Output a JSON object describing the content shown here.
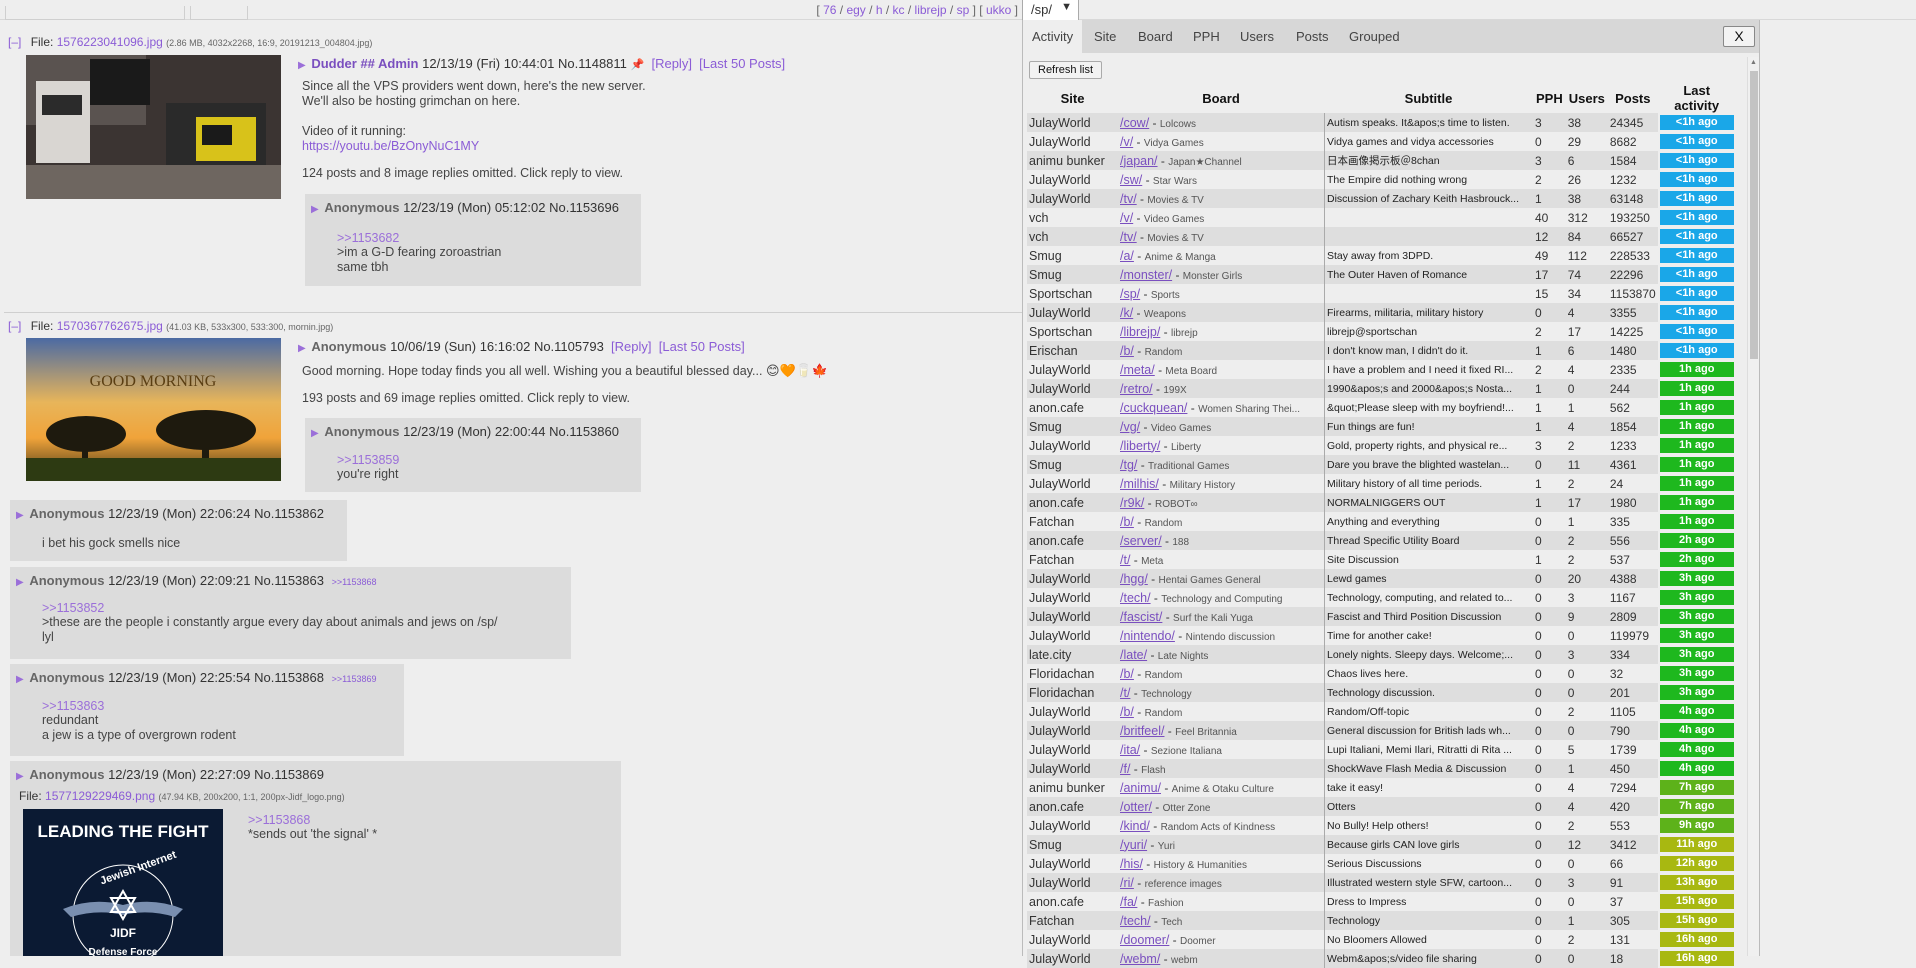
{
  "topnav": {
    "open": "[",
    "links": [
      "76",
      "egy",
      "h",
      "kc",
      "librejp",
      "sp"
    ],
    "mid": "] [",
    "extra": "ukko",
    "close": "]",
    "board_select": "/sp/"
  },
  "threads": [
    {
      "collapse": "[–]",
      "file_label": "File:",
      "file_name": "1576223041096.jpg",
      "file_info": "(2.86 MB, 4032x2268, 16:9, 20191213_004804.jpg)",
      "name": "Dudder ## Admin",
      "date": "12/13/19 (Fri) 10:44:01",
      "no": "No.1148811",
      "reply_link": "[Reply]",
      "last50": "[Last 50 Posts]",
      "body": [
        "Since all the VPS providers went down, here's the new server.",
        "We'll also be hosting grimchan on here."
      ],
      "body2": "Video of it running:",
      "link": "https://youtu.be/BzOnyNuC1MY",
      "omitted": "124 posts and 8 image replies omitted. Click reply to view."
    },
    {
      "collapse": "[–]",
      "file_label": "File:",
      "file_name": "1570367762675.jpg",
      "file_info": "(41.03 KB, 533x300, 533:300, mornin.jpg)",
      "thumb_text": "GOOD MORNING",
      "name": "Anonymous",
      "date": "10/06/19 (Sun) 16:16:02",
      "no": "No.1105793",
      "reply_link": "[Reply]",
      "last50": "[Last 50 Posts]",
      "body": "Good morning. Hope today finds you all well. Wishing you a beautiful blessed day...",
      "omitted": "193 posts and 69 image replies omitted. Click reply to view."
    }
  ],
  "replies": [
    {
      "name": "Anonymous",
      "date": "12/23/19 (Mon) 05:12:02",
      "no": "No.1153696",
      "backlink": "",
      "quote": ">>1153682",
      "green": ">im a G-D fearing zoroastrian",
      "text": "same tbh"
    },
    {
      "name": "Anonymous",
      "date": "12/23/19 (Mon) 22:00:44",
      "no": "No.1153860",
      "backlink": "",
      "quote": ">>1153859",
      "green": "",
      "text": "you're right"
    },
    {
      "name": "Anonymous",
      "date": "12/23/19 (Mon) 22:06:24",
      "no": "No.1153862",
      "backlink": "",
      "quote": "",
      "green": "",
      "text": "i bet his gock smells nice"
    },
    {
      "name": "Anonymous",
      "date": "12/23/19 (Mon) 22:09:21",
      "no": "No.1153863",
      "backlink": ">>1153868",
      "quote": ">>1153852",
      "green": ">these are the people i constantly argue every day about animals and jews on /sp/",
      "text": "lyl"
    },
    {
      "name": "Anonymous",
      "date": "12/23/19 (Mon) 22:25:54",
      "no": "No.1153868",
      "backlink": ">>1153869",
      "quote": ">>1153863",
      "green": "",
      "text": "redundant",
      "text2": "a jew is a type of overgrown rodent"
    },
    {
      "name": "Anonymous",
      "date": "12/23/19 (Mon) 22:27:09",
      "no": "No.1153869",
      "backlink": "",
      "file_label": "File:",
      "file_name": "1577129229469.png",
      "file_info": "(47.94 KB, 200x200, 1:1, 200px-Jidf_logo.png)",
      "thumb_title": "LEADING THE FIGHT",
      "thumb_arc": "Jewish Internet",
      "thumb_abbr": "JIDF",
      "thumb_bottom": "Defense Force",
      "quote": ">>1153868",
      "text": "*sends out 'the signal' *"
    }
  ],
  "panel": {
    "tabs": [
      "Activity",
      "Site",
      "Board",
      "PPH",
      "Users",
      "Posts",
      "Grouped"
    ],
    "close": "X",
    "refresh": "Refresh list",
    "headers": [
      "Site",
      "Board",
      "Subtitle",
      "PPH",
      "Users",
      "Posts",
      "Last activity"
    ],
    "colors": {
      "fresh": "#1aa7e8",
      "hour": "#1eb81e",
      "mid": "#5db21a",
      "old": "#a8b811"
    },
    "rows": [
      [
        "JulayWorld",
        "/cow/",
        "Lolcows",
        "Autism speaks. It&apos;s time to listen.",
        "3",
        "38",
        "24345",
        "<1h ago",
        "fresh"
      ],
      [
        "JulayWorld",
        "/v/",
        "Vidya Games",
        "Vidya games and vidya accessories",
        "0",
        "29",
        "8682",
        "<1h ago",
        "fresh"
      ],
      [
        "animu bunker",
        "/japan/",
        "Japan★Channel",
        "日本画像掲示板＠8chan",
        "3",
        "6",
        "1584",
        "<1h ago",
        "fresh"
      ],
      [
        "JulayWorld",
        "/sw/",
        "Star Wars",
        "The Empire did nothing wrong",
        "2",
        "26",
        "1232",
        "<1h ago",
        "fresh"
      ],
      [
        "JulayWorld",
        "/tv/",
        "Movies & TV",
        "Discussion of Zachary Keith Hasbrouck...",
        "1",
        "38",
        "63148",
        "<1h ago",
        "fresh"
      ],
      [
        "vch",
        "/v/",
        "Video Games",
        "",
        "40",
        "312",
        "193250",
        "<1h ago",
        "fresh"
      ],
      [
        "vch",
        "/tv/",
        "Movies & TV",
        "",
        "12",
        "84",
        "66527",
        "<1h ago",
        "fresh"
      ],
      [
        "Smug",
        "/a/",
        "Anime & Manga",
        "Stay away from 3DPD.",
        "49",
        "112",
        "228533",
        "<1h ago",
        "fresh"
      ],
      [
        "Smug",
        "/monster/",
        "Monster Girls",
        "The Outer Haven of Romance",
        "17",
        "74",
        "22296",
        "<1h ago",
        "fresh"
      ],
      [
        "Sportschan",
        "/sp/",
        "Sports",
        "",
        "15",
        "34",
        "1153870",
        "<1h ago",
        "fresh"
      ],
      [
        "JulayWorld",
        "/k/",
        "Weapons",
        "Firearms, militaria, military history",
        "0",
        "4",
        "3355",
        "<1h ago",
        "fresh"
      ],
      [
        "Sportschan",
        "/librejp/",
        "librejp",
        "librejp@sportschan",
        "2",
        "17",
        "14225",
        "<1h ago",
        "fresh"
      ],
      [
        "Erischan",
        "/b/",
        "Random",
        "I don't know man, I didn't do it.",
        "1",
        "6",
        "1480",
        "<1h ago",
        "fresh"
      ],
      [
        "JulayWorld",
        "/meta/",
        "Meta Board",
        "I have a problem and I need it fixed RI...",
        "2",
        "4",
        "2335",
        "1h ago",
        "hour"
      ],
      [
        "JulayWorld",
        "/retro/",
        "199X",
        "1990&apos;s and 2000&apos;s Nosta...",
        "1",
        "0",
        "244",
        "1h ago",
        "hour"
      ],
      [
        "anon.cafe",
        "/cuckquean/",
        "Women Sharing Thei...",
        "&quot;Please sleep with my boyfriend!...",
        "1",
        "1",
        "562",
        "1h ago",
        "hour"
      ],
      [
        "Smug",
        "/vg/",
        "Video Games",
        "Fun things are fun!",
        "1",
        "4",
        "1854",
        "1h ago",
        "hour"
      ],
      [
        "JulayWorld",
        "/liberty/",
        "Liberty",
        "Gold, property rights, and physical re...",
        "3",
        "2",
        "1233",
        "1h ago",
        "hour"
      ],
      [
        "Smug",
        "/tg/",
        "Traditional Games",
        "Dare you brave the blighted wastelan...",
        "0",
        "11",
        "4361",
        "1h ago",
        "hour"
      ],
      [
        "JulayWorld",
        "/milhis/",
        "Military History",
        "Military history of all time periods.",
        "1",
        "2",
        "24",
        "1h ago",
        "hour"
      ],
      [
        "anon.cafe",
        "/r9k/",
        "ROBOT∞",
        "NORMALNIGGERS OUT",
        "1",
        "17",
        "1980",
        "1h ago",
        "hour"
      ],
      [
        "Fatchan",
        "/b/",
        "Random",
        "Anything and everything",
        "0",
        "1",
        "335",
        "1h ago",
        "hour"
      ],
      [
        "anon.cafe",
        "/server/",
        "188",
        "Thread Specific Utility Board",
        "0",
        "2",
        "556",
        "2h ago",
        "hour"
      ],
      [
        "Fatchan",
        "/t/",
        "Meta",
        "Site Discussion",
        "1",
        "2",
        "537",
        "2h ago",
        "hour"
      ],
      [
        "JulayWorld",
        "/hgg/",
        "Hentai Games General",
        "Lewd games",
        "0",
        "20",
        "4388",
        "3h ago",
        "hour"
      ],
      [
        "JulayWorld",
        "/tech/",
        "Technology and Computing",
        "Technology, computing, and related to...",
        "0",
        "3",
        "1167",
        "3h ago",
        "hour"
      ],
      [
        "JulayWorld",
        "/fascist/",
        "Surf the Kali Yuga",
        "Fascist and Third Position Discussion",
        "0",
        "9",
        "2809",
        "3h ago",
        "hour"
      ],
      [
        "JulayWorld",
        "/nintendo/",
        "Nintendo discussion",
        "Time for another cake!",
        "0",
        "0",
        "119979",
        "3h ago",
        "hour"
      ],
      [
        "late.city",
        "/late/",
        "Late Nights",
        "Lonely nights. Sleepy days. Welcome;...",
        "0",
        "3",
        "334",
        "3h ago",
        "hour"
      ],
      [
        "Floridachan",
        "/b/",
        "Random",
        "Chaos lives here.",
        "0",
        "0",
        "32",
        "3h ago",
        "hour"
      ],
      [
        "Floridachan",
        "/t/",
        "Technology",
        "Technology discussion.",
        "0",
        "0",
        "201",
        "3h ago",
        "hour"
      ],
      [
        "JulayWorld",
        "/b/",
        "Random",
        "Random/Off-topic",
        "0",
        "2",
        "1105",
        "4h ago",
        "hour"
      ],
      [
        "JulayWorld",
        "/britfeel/",
        "Feel Britannia",
        "General discussion for British lads wh...",
        "0",
        "0",
        "790",
        "4h ago",
        "hour"
      ],
      [
        "JulayWorld",
        "/ita/",
        "Sezione Italiana",
        "Lupi Italiani, Memi Ilari, Ritratti di Rita ...",
        "0",
        "5",
        "1739",
        "4h ago",
        "hour"
      ],
      [
        "JulayWorld",
        "/f/",
        "Flash",
        "ShockWave Flash Media & Discussion",
        "0",
        "1",
        "450",
        "4h ago",
        "hour"
      ],
      [
        "animu bunker",
        "/animu/",
        "Anime & Otaku Culture",
        "take it easy!",
        "0",
        "4",
        "7294",
        "7h ago",
        "mid"
      ],
      [
        "anon.cafe",
        "/otter/",
        "Otter Zone",
        "Otters",
        "0",
        "4",
        "420",
        "7h ago",
        "mid"
      ],
      [
        "JulayWorld",
        "/kind/",
        "Random Acts of Kindness",
        "No Bully! Help others!",
        "0",
        "2",
        "553",
        "9h ago",
        "mid"
      ],
      [
        "Smug",
        "/yuri/",
        "Yuri",
        "Because girls CAN love girls",
        "0",
        "12",
        "3412",
        "11h ago",
        "old"
      ],
      [
        "JulayWorld",
        "/his/",
        "History & Humanities",
        "Serious Discussions",
        "0",
        "0",
        "66",
        "12h ago",
        "old"
      ],
      [
        "JulayWorld",
        "/ri/",
        "reference images",
        "Illustrated western style SFW, cartoon...",
        "0",
        "3",
        "91",
        "13h ago",
        "old"
      ],
      [
        "anon.cafe",
        "/fa/",
        "Fashion",
        "Dress to Impress",
        "0",
        "0",
        "37",
        "15h ago",
        "old"
      ],
      [
        "Fatchan",
        "/tech/",
        "Tech",
        "Technology",
        "0",
        "1",
        "305",
        "15h ago",
        "old"
      ],
      [
        "JulayWorld",
        "/doomer/",
        "Doomer",
        "No Bloomers Allowed",
        "0",
        "2",
        "131",
        "16h ago",
        "old"
      ],
      [
        "JulayWorld",
        "/webm/",
        "webm",
        "Webm&apos;s/video file sharing",
        "0",
        "0",
        "18",
        "16h ago",
        "old"
      ]
    ]
  }
}
